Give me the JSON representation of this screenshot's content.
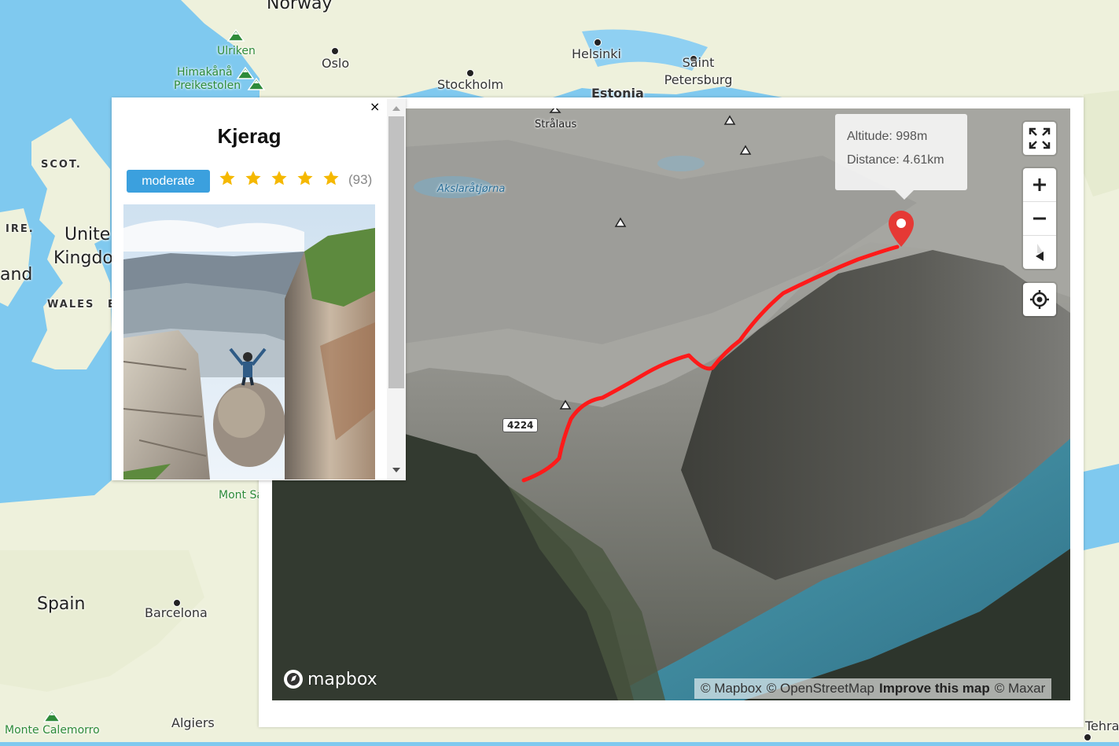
{
  "basemap": {
    "countries": [
      "Norway",
      "United Kingdom",
      "Spain",
      "Estonia"
    ],
    "regions": [
      "SCOT.",
      "IRE.",
      "WALES"
    ],
    "cities": [
      "Oslo",
      "Stockholm",
      "Helsinki",
      "Saint Petersburg",
      "Barcelona",
      "Algiers",
      "Tehran"
    ],
    "partial_labels": [
      "and",
      "Unite",
      "Kingdo",
      "Mont Sa",
      "E"
    ],
    "pois": [
      "Ulriken",
      "Himakånå",
      "Preikestolen",
      "Monte Calemorro"
    ]
  },
  "card": {
    "close": "×",
    "title": "Kjerag",
    "difficulty": "moderate",
    "rating": 5,
    "max_rating": 5,
    "reviews": "(93)",
    "photo_icon": "kjeragbolten-photo"
  },
  "terrain": {
    "labels": [
      "Strålaus",
      "Akslaråtjørna"
    ],
    "road_shield": "4224",
    "tooltip": {
      "altitude": "Altitude: 998m",
      "distance": "Distance: 4.61km"
    },
    "route_color": "#ff1a1a",
    "marker_color": "#e53935"
  },
  "controls": {
    "fullscreen": "fullscreen-icon",
    "zoom_in": "plus-icon",
    "zoom_out": "minus-icon",
    "compass": "compass-icon",
    "geolocate": "geolocate-icon"
  },
  "footer": {
    "logo": "mapbox",
    "attr_mapbox": "© Mapbox",
    "attr_osm": "© OpenStreetMap",
    "attr_improve": "Improve this map",
    "attr_maxar": "© Maxar"
  },
  "colors": {
    "land": "#eef1dc",
    "water": "#7fc9ef",
    "difficulty": "#3ba0de",
    "star": "#f5b800"
  }
}
